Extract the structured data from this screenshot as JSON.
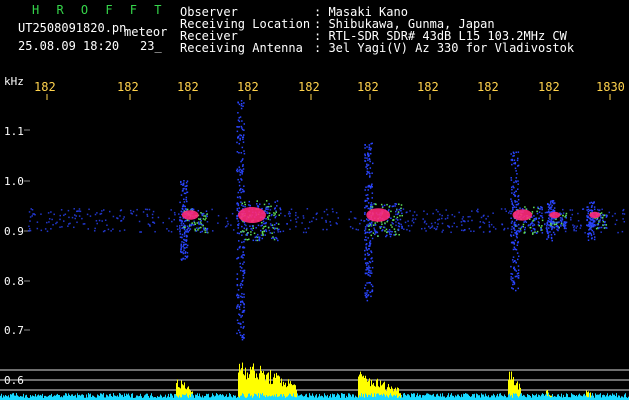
{
  "header": {
    "app_name": "H R O F F T",
    "filename": "UT2508091820.pn",
    "tag": "meteor",
    "date_time": "25.08.09 18:20",
    "frame_no": "23_",
    "fields": [
      {
        "label": "Observer",
        "value": ": Masaki Kano"
      },
      {
        "label": "Receiving Location",
        "value": ": Shibukawa, Gunma, Japan"
      },
      {
        "label": "Receiver",
        "value": ": RTL-SDR SDR# 43dB L15 103.2MHz CW"
      },
      {
        "label": "Receiving Antenna",
        "value": ": 3el Yagi(V) Az 330 for Vladivostok"
      }
    ]
  },
  "axis": {
    "unit": "kHz",
    "x_ticks": [
      "182",
      "182",
      "182",
      "182",
      "182",
      "182",
      "182",
      "182",
      "182",
      "1830"
    ],
    "y_ticks": [
      "1.1",
      "1.0",
      "0.9",
      "0.8",
      "0.7",
      "0.6"
    ]
  },
  "colors": {
    "background": "#000000",
    "header_title": "#35d64a",
    "tick_labels": "#ffd34d",
    "signal_hot": "#ff2a7a",
    "signal_mid": "#2a45ff",
    "signal_low": "#5fe05a",
    "activity": "#ffff00",
    "baseline": "#18d8ff"
  }
}
